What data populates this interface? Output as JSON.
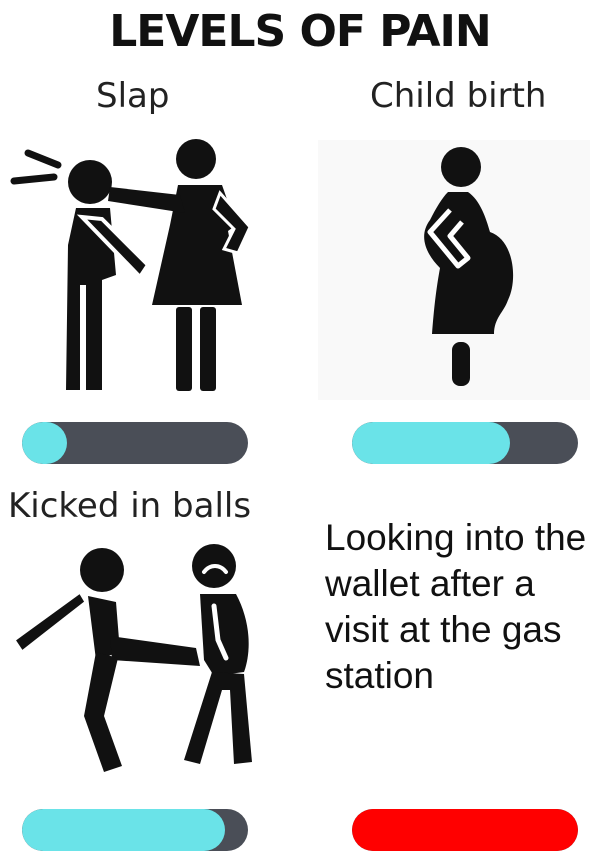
{
  "title": "LEVELS OF PAIN",
  "panels": [
    {
      "label": "Slap",
      "pain_level": 0.2,
      "fill_color": "#6ae3e8",
      "icon": "slap-icon"
    },
    {
      "label": "Child birth",
      "pain_level": 0.7,
      "fill_color": "#6ae3e8",
      "icon": "pregnant-woman-icon"
    },
    {
      "label": "Kicked in balls",
      "pain_level": 0.9,
      "fill_color": "#6ae3e8",
      "icon": "kick-icon"
    },
    {
      "label": "Looking into the wallet after a visit at the gas station",
      "pain_level": 1.0,
      "fill_color": "#ff0000",
      "icon": ""
    }
  ],
  "track_color": "#4a4e57"
}
